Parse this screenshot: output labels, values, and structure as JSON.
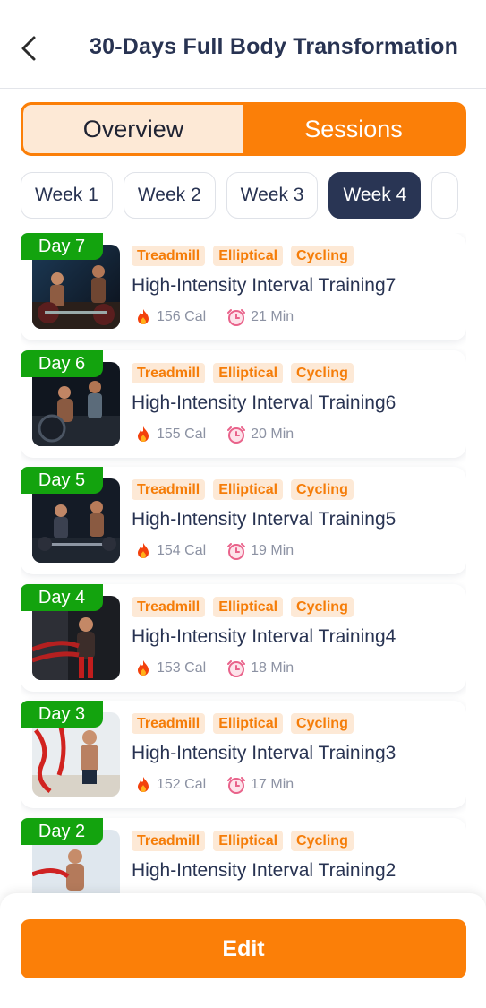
{
  "header": {
    "title": "30-Days Full Body Transformation"
  },
  "segment": {
    "overview_label": "Overview",
    "sessions_label": "Sessions"
  },
  "weeks": [
    "Week 1",
    "Week 2",
    "Week 3",
    "Week 4"
  ],
  "active_week": "Week 4",
  "sessions": [
    {
      "day": "Day 7",
      "tags": [
        "Treadmill",
        "Elliptical",
        "Cycling"
      ],
      "title": "High-Intensity Interval Training7",
      "calories": "156 Cal",
      "duration": "21 Min"
    },
    {
      "day": "Day 6",
      "tags": [
        "Treadmill",
        "Elliptical",
        "Cycling"
      ],
      "title": "High-Intensity Interval Training6",
      "calories": "155 Cal",
      "duration": "20 Min"
    },
    {
      "day": "Day 5",
      "tags": [
        "Treadmill",
        "Elliptical",
        "Cycling"
      ],
      "title": "High-Intensity Interval Training5",
      "calories": "154 Cal",
      "duration": "19 Min"
    },
    {
      "day": "Day 4",
      "tags": [
        "Treadmill",
        "Elliptical",
        "Cycling"
      ],
      "title": "High-Intensity Interval Training4",
      "calories": "153 Cal",
      "duration": "18 Min"
    },
    {
      "day": "Day 3",
      "tags": [
        "Treadmill",
        "Elliptical",
        "Cycling"
      ],
      "title": "High-Intensity Interval Training3",
      "calories": "152 Cal",
      "duration": "17 Min"
    },
    {
      "day": "Day 2",
      "tags": [
        "Treadmill",
        "Elliptical",
        "Cycling"
      ],
      "title": "High-Intensity Interval Training2",
      "calories": "",
      "duration": ""
    }
  ],
  "footer": {
    "edit_label": "Edit"
  },
  "colors": {
    "accent": "#fb7f08",
    "navy": "#293554",
    "day_badge": "#13a30e",
    "tag_bg": "#fde9d6"
  },
  "icons": {
    "back": "chevron-left-icon",
    "calories": "fire-icon",
    "duration": "clock-icon"
  }
}
